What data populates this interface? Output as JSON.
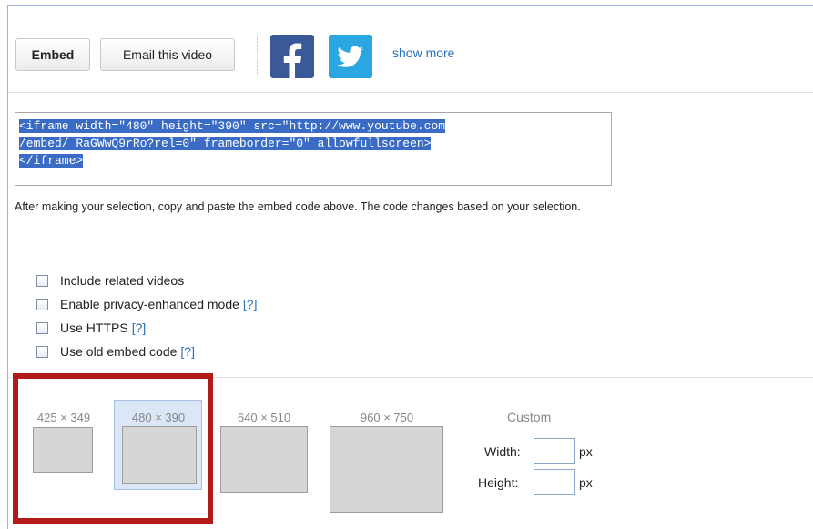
{
  "share": {
    "embed_label": "Embed",
    "email_label": "Email this video",
    "show_more": "show more",
    "facebook_icon": "facebook-icon",
    "twitter_icon": "twitter-icon"
  },
  "embed_code": {
    "lines": [
      "<iframe width=\"480\" height=\"390\" src=\"http://www.youtube.com",
      "/embed/_RaGWwQ9rRo?rel=0\" frameborder=\"0\" allowfullscreen>",
      "</iframe>"
    ],
    "help_text": "After making your selection, copy and paste the embed code above. The code changes based on your selection."
  },
  "options": [
    {
      "label": "Include related videos",
      "help": "",
      "checked": false
    },
    {
      "label": "Enable privacy-enhanced mode",
      "help": "[?]",
      "checked": false
    },
    {
      "label": "Use HTTPS",
      "help": "[?]",
      "checked": false
    },
    {
      "label": "Use old embed code",
      "help": "[?]",
      "checked": false
    }
  ],
  "sizes": [
    {
      "label": "425 × 349",
      "selected": false
    },
    {
      "label": "480 × 390",
      "selected": true
    },
    {
      "label": "640 × 510",
      "selected": false
    },
    {
      "label": "960 × 750",
      "selected": false
    }
  ],
  "custom": {
    "title": "Custom",
    "width_label": "Width:",
    "height_label": "Height:",
    "width_value": "",
    "height_value": "",
    "unit": "px"
  },
  "colors": {
    "highlight": "#b31b1b",
    "selection": "#3a6cc6",
    "link": "#2a6fb8"
  }
}
